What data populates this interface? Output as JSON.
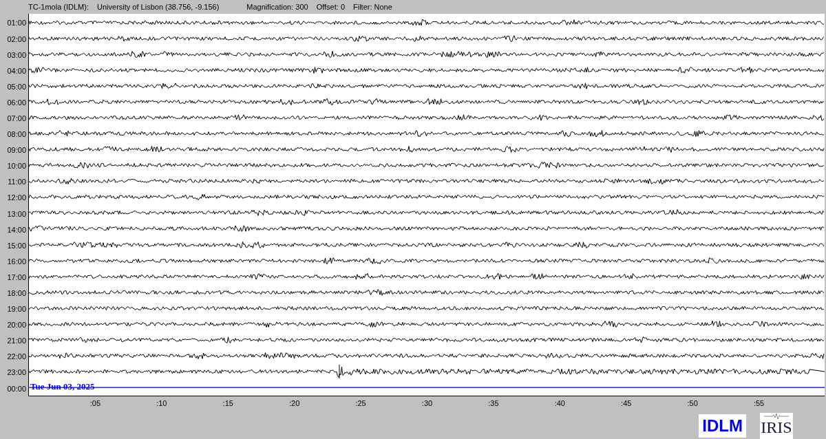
{
  "header": {
    "station": "TC-1mola (IDLM):",
    "location": "University of Lisbon (38.756, -9.156)",
    "magnification": "Magnification: 300",
    "offset": "Offset: 0",
    "filter": "Filter: None"
  },
  "rows": [
    {
      "label": "01:00",
      "kind": "trace"
    },
    {
      "label": "02:00",
      "kind": "trace"
    },
    {
      "label": "03:00",
      "kind": "trace"
    },
    {
      "label": "04:00",
      "kind": "trace"
    },
    {
      "label": "05:00",
      "kind": "trace"
    },
    {
      "label": "06:00",
      "kind": "trace"
    },
    {
      "label": "07:00",
      "kind": "trace"
    },
    {
      "label": "08:00",
      "kind": "trace"
    },
    {
      "label": "09:00",
      "kind": "trace"
    },
    {
      "label": "10:00",
      "kind": "trace"
    },
    {
      "label": "11:00",
      "kind": "trace"
    },
    {
      "label": "12:00",
      "kind": "trace"
    },
    {
      "label": "13:00",
      "kind": "trace"
    },
    {
      "label": "14:00",
      "kind": "trace"
    },
    {
      "label": "15:00",
      "kind": "trace"
    },
    {
      "label": "16:00",
      "kind": "trace"
    },
    {
      "label": "17:00",
      "kind": "trace"
    },
    {
      "label": "18:00",
      "kind": "trace"
    },
    {
      "label": "19:00",
      "kind": "trace"
    },
    {
      "label": "20:00",
      "kind": "trace"
    },
    {
      "label": "21:00",
      "kind": "trace"
    },
    {
      "label": "22:00",
      "kind": "trace"
    },
    {
      "label": "23:00",
      "kind": "event"
    },
    {
      "label": "00:00",
      "kind": "current"
    }
  ],
  "date": "Tue Jun 03, 2025",
  "xticks": [
    ":05",
    ":10",
    ":15",
    ":20",
    ":25",
    ":30",
    ":35",
    ":40",
    ":45",
    ":50",
    ":55"
  ],
  "logos": [
    {
      "kind": "text",
      "text": "IDLM"
    },
    {
      "kind": "emblem",
      "text": "IRIS"
    }
  ]
}
